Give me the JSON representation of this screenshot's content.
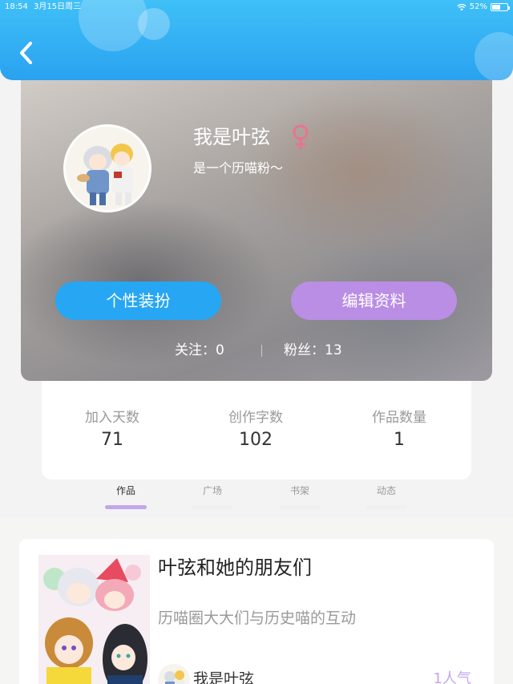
{
  "status_bar": {
    "time": "18:54",
    "date": "3月15日周三",
    "battery": "52%"
  },
  "profile": {
    "username": "我是叶弦",
    "gender_symbol": "♀",
    "bio": "是一个历喵粉～",
    "buttons": {
      "dressup": "个性装扮",
      "edit": "编辑资料"
    },
    "following_label": "关注：",
    "following_count": "0",
    "followers_label": "粉丝：",
    "followers_count": "13"
  },
  "stats": [
    {
      "label": "加入天数",
      "value": "71"
    },
    {
      "label": "创作字数",
      "value": "102"
    },
    {
      "label": "作品数量",
      "value": "1"
    }
  ],
  "tabs": [
    {
      "label": "作品",
      "active": true
    },
    {
      "label": "广场",
      "active": false
    },
    {
      "label": "书架",
      "active": false
    },
    {
      "label": "动态",
      "active": false
    }
  ],
  "works": [
    {
      "title": "叶弦和她的朋友们",
      "description": "历喵圈大大们与历史喵的互动",
      "author": "我是叶弦",
      "popularity": "1人气"
    }
  ],
  "colors": {
    "header_blue": "#2aa2f0",
    "dressup_button": "#27a6f3",
    "edit_button": "#b98ee4",
    "accent_purple": "#c3a6ea",
    "gender_pink": "#e8748f"
  }
}
